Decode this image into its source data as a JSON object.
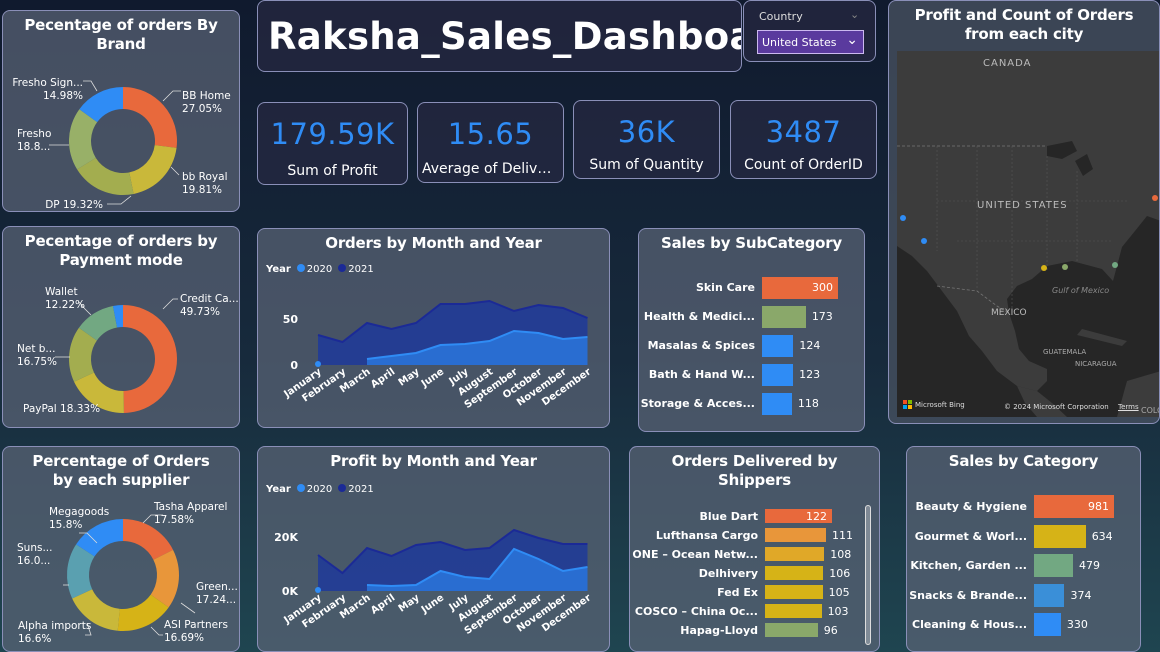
{
  "title": "Raksha_Sales_Dashboard",
  "country_filter": {
    "label": "Country",
    "value": "United States"
  },
  "kpis": [
    {
      "value": "179.59K",
      "label": "Sum of Profit"
    },
    {
      "value": "15.65",
      "label": "Average of Deliver..."
    },
    {
      "value": "36K",
      "label": "Sum of Quantity"
    },
    {
      "value": "3487",
      "label": "Count of OrderID"
    }
  ],
  "brand_donut": {
    "title": "Pecentage of orders By Brand",
    "segments": [
      {
        "label": "BB Home",
        "pct": "27.05%",
        "value": 27.05,
        "color": "#e8693c"
      },
      {
        "label": "bb Royal",
        "pct": "19.81%",
        "value": 19.81,
        "color": "#c9b83a"
      },
      {
        "label": "DP 19.32%",
        "pct": "",
        "value": 19.32,
        "color": "#a3ad4f"
      },
      {
        "label": "Fresho",
        "pct": "18.8...",
        "value": 18.84,
        "color": "#98b068"
      },
      {
        "label": "Fresho Sign...",
        "pct": "14.98%",
        "value": 14.98,
        "color": "#2f8cf5"
      }
    ]
  },
  "payment_donut": {
    "title": "Pecentage of orders by Payment mode",
    "segments": [
      {
        "label": "Credit Ca...",
        "pct": "49.73%",
        "value": 49.73,
        "color": "#e8693c"
      },
      {
        "label": "PayPal 18.33%",
        "pct": "",
        "value": 18.33,
        "color": "#c9b83a"
      },
      {
        "label": "Net b...",
        "pct": "16.75%",
        "value": 16.75,
        "color": "#a3ad4f"
      },
      {
        "label": "Wallet",
        "pct": "12.22%",
        "value": 12.22,
        "color": "#72a882"
      },
      {
        "label": "",
        "pct": "",
        "value": 2.97,
        "color": "#2f8cf5"
      }
    ]
  },
  "supplier_donut": {
    "title": "Percentage of Orders by each supplier",
    "segments": [
      {
        "label": "Tasha Apparel",
        "pct": "17.58%",
        "value": 17.58,
        "color": "#e8693c"
      },
      {
        "label": "Green...",
        "pct": "17.24...",
        "value": 17.24,
        "color": "#e8963a"
      },
      {
        "label": "ASI Partners",
        "pct": "16.69%",
        "value": 16.69,
        "color": "#d6b317"
      },
      {
        "label": "Alpha imports",
        "pct": "16.6%",
        "value": 16.6,
        "color": "#c9b83a"
      },
      {
        "label": "Suns...",
        "pct": "16.0...",
        "value": 16.09,
        "color": "#5aa0b0"
      },
      {
        "label": "Megagoods",
        "pct": "15.8%",
        "value": 15.8,
        "color": "#2f8cf5"
      }
    ]
  },
  "orders_by_month": {
    "title": "Orders by Month and Year",
    "legend_title": "Year",
    "series_names": [
      "2020",
      "2021"
    ],
    "y_ticks": [
      "50",
      "0"
    ],
    "months": [
      "January",
      "February",
      "March",
      "April",
      "May",
      "June",
      "July",
      "August",
      "September",
      "October",
      "November",
      "December"
    ]
  },
  "profit_by_month": {
    "title": "Profit by Month and Year",
    "legend_title": "Year",
    "series_names": [
      "2020",
      "2021"
    ],
    "y_ticks": [
      "20K",
      "0K"
    ],
    "months": [
      "January",
      "February",
      "March",
      "April",
      "May",
      "June",
      "July",
      "August",
      "September",
      "October",
      "November",
      "December"
    ]
  },
  "subcategory": {
    "title": "Sales by SubCategory",
    "items": [
      {
        "label": "Skin Care",
        "value": "300",
        "color": "#e8693c"
      },
      {
        "label": "Health & Medici...",
        "value": "173",
        "color": "#8aa86a"
      },
      {
        "label": "Masalas & Spices",
        "value": "124",
        "color": "#2f8cf5"
      },
      {
        "label": "Bath & Hand W...",
        "value": "123",
        "color": "#2f8cf5"
      },
      {
        "label": "Storage & Acces...",
        "value": "118",
        "color": "#2f8cf5"
      }
    ]
  },
  "shippers": {
    "title": "Orders Delivered by Shippers",
    "items": [
      {
        "label": "Blue Dart",
        "value": "122",
        "color": "#e8693c"
      },
      {
        "label": "Lufthansa Cargo",
        "value": "111",
        "color": "#e8963a"
      },
      {
        "label": "ONE – Ocean Netw...",
        "value": "108",
        "color": "#e0a828"
      },
      {
        "label": "Delhivery",
        "value": "106",
        "color": "#d6b317"
      },
      {
        "label": "Fed Ex",
        "value": "105",
        "color": "#d6b317"
      },
      {
        "label": "COSCO – China Oc...",
        "value": "103",
        "color": "#d6b317"
      },
      {
        "label": "Hapag-Lloyd",
        "value": "96",
        "color": "#8aa86a"
      }
    ]
  },
  "category": {
    "title": "Sales by Category",
    "items": [
      {
        "label": "Beauty & Hygiene",
        "value": "981",
        "color": "#e8693c"
      },
      {
        "label": "Gourmet & Worl...",
        "value": "634",
        "color": "#d6b317"
      },
      {
        "label": "Kitchen, Garden ...",
        "value": "479",
        "color": "#72a882"
      },
      {
        "label": "Snacks & Brande...",
        "value": "374",
        "color": "#3a8fd8"
      },
      {
        "label": "Cleaning & Hous...",
        "value": "330",
        "color": "#2f8cf5"
      }
    ]
  },
  "map": {
    "title": "Profit and Count of Orders from each city",
    "labels": [
      "CANADA",
      "UNITED STATES",
      "MEXICO",
      "Gulf of Mexico",
      "GUATEMALA",
      "NICARAGUA",
      "COLO"
    ],
    "bing": "Microsoft Bing",
    "copyright": "© 2024 Microsoft Corporation",
    "terms": "Terms"
  },
  "colors": {
    "s2020": "#2f8cf5",
    "s2021": "#1b2a96"
  }
}
